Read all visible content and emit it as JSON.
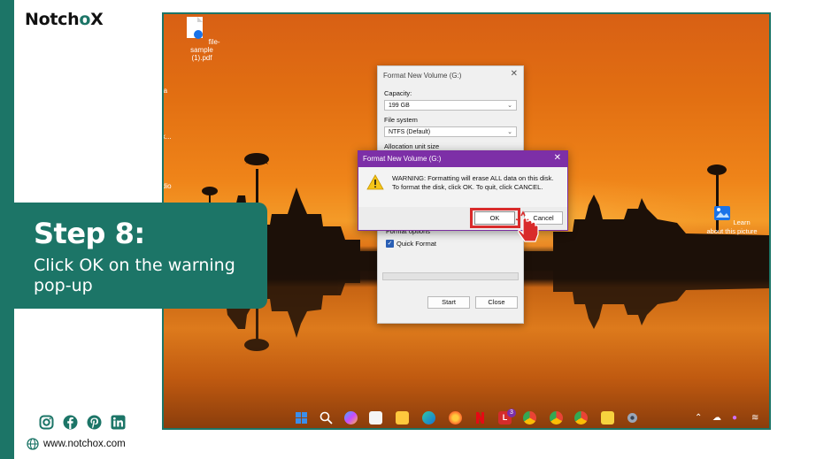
{
  "brand": {
    "name_prefix": "Notch",
    "name_suffix": "X",
    "website": "www.notchox.com"
  },
  "step": {
    "title": "Step 8:",
    "description": "Click OK on the warning pop-up"
  },
  "desktop": {
    "icons": [
      {
        "label": "file-sample (1).pdf"
      },
      {
        "label": "ia"
      },
      {
        "label": "pk..."
      },
      {
        "label": "udio"
      }
    ],
    "learn_label": "Learn about this picture"
  },
  "format_window": {
    "title": "Format New Volume (G:)",
    "capacity_label": "Capacity:",
    "capacity_value": "199 GB",
    "filesystem_label": "File system",
    "filesystem_value": "NTFS (Default)",
    "allocation_label": "Allocation unit size",
    "format_options_label": "Format options",
    "quick_format_label": "Quick Format",
    "start_button": "Start",
    "close_button": "Close"
  },
  "warning_dialog": {
    "title": "Format New Volume (G:)",
    "line1": "WARNING: Formatting will erase ALL data on this disk.",
    "line2": "To format the disk, click OK. To quit, click CANCEL.",
    "ok_button": "OK",
    "cancel_button": "Cancel"
  },
  "taskbar": {
    "badge_count": "3"
  },
  "colors": {
    "brand_teal": "#1c7567",
    "dialog_purple": "#7d2fa7",
    "highlight_red": "#d92b2b"
  }
}
